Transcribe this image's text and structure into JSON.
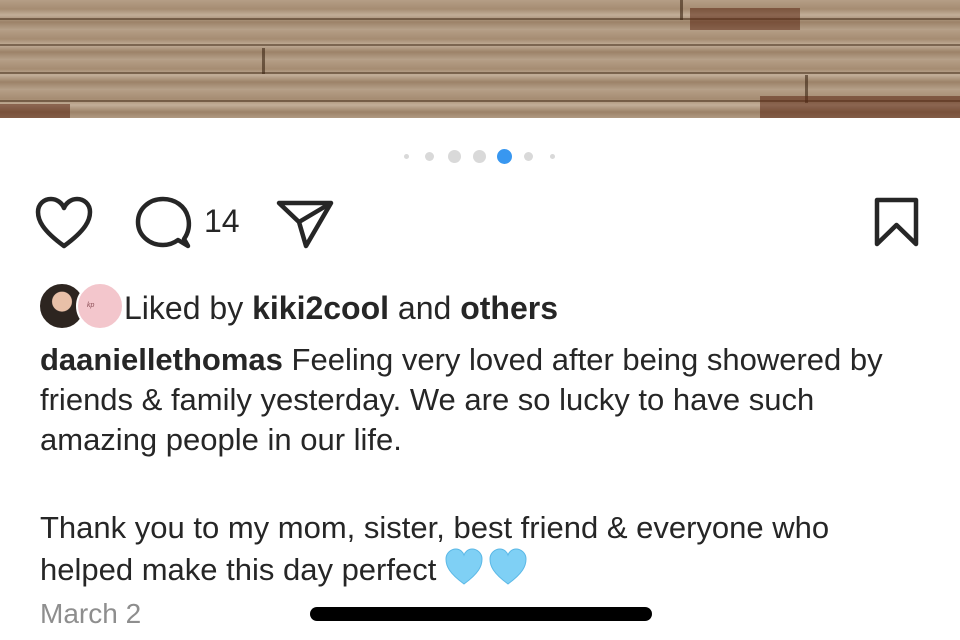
{
  "post": {
    "carousel": {
      "total": 7,
      "active_index": 4
    },
    "actions": {
      "like_icon": "heart-outline-icon",
      "comment_icon": "comment-bubble-icon",
      "share_icon": "paper-plane-icon",
      "save_icon": "bookmark-icon",
      "comment_count": "14"
    },
    "likes": {
      "prefix": "Liked by",
      "user": "kiki2cool",
      "connector": "and",
      "others": "others",
      "avatar2_text": "kp"
    },
    "caption": {
      "username": "daaniellethomas",
      "paragraph1": "Feeling very loved after being showered by friends & family yesterday. We are so lucky to have such amazing people in our life.",
      "paragraph2": "Thank you to my mom, sister, best friend & everyone who helped make this day perfect",
      "emoji": "light-blue-heart"
    },
    "date": "March 2"
  },
  "colors": {
    "accent": "#3897f0",
    "text": "#262626",
    "muted": "#8e8e8e",
    "emoji_heart": "#7fd0f5"
  }
}
